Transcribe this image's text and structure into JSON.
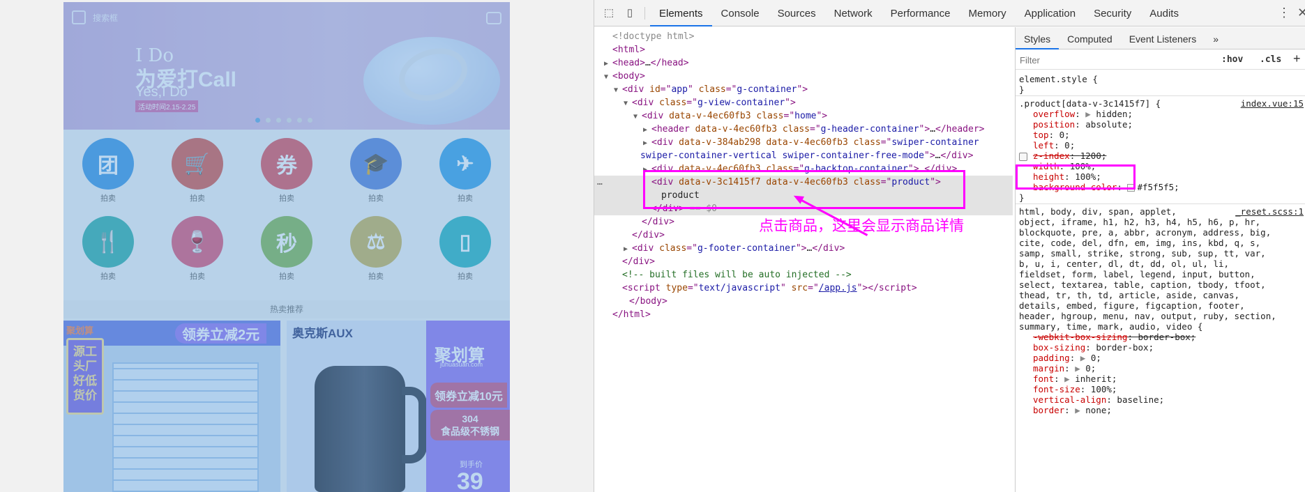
{
  "page": {
    "search_placeholder": "搜索框",
    "banner": {
      "line1": "I Do",
      "line2": "为爱打Call",
      "line3": "Yes,I Do",
      "line4": "活动时间2.15-2.25"
    },
    "dots_count": 6,
    "categories": [
      {
        "icon": "团",
        "label": "拍卖",
        "color": "#2f8ee0",
        "icon_name": "group-buy-icon"
      },
      {
        "icon": "🛒",
        "label": "拍卖",
        "color": "#d74b3c",
        "icon_name": "cart-icon"
      },
      {
        "icon": "券",
        "label": "拍卖",
        "color": "#e0464f",
        "icon_name": "coupon-icon"
      },
      {
        "icon": "🎓",
        "label": "拍卖",
        "color": "#4d78d6",
        "icon_name": "graduation-icon"
      },
      {
        "icon": "✈",
        "label": "拍卖",
        "color": "#2a9be6",
        "icon_name": "plane-icon"
      },
      {
        "icon": "🍴",
        "label": "拍卖",
        "color": "#23a9a0",
        "icon_name": "fork-knife-icon"
      },
      {
        "icon": "🍷",
        "label": "拍卖",
        "color": "#e14a6b",
        "icon_name": "wine-icon"
      },
      {
        "icon": "秒",
        "label": "拍卖",
        "color": "#7cb342",
        "icon_name": "flash-sale-icon"
      },
      {
        "icon": "⚖",
        "label": "拍卖",
        "color": "#c8b04a",
        "icon_name": "hammer-icon"
      },
      {
        "icon": "▯",
        "label": "拍卖",
        "color": "#1ab0b8",
        "icon_name": "phone-icon"
      }
    ],
    "section_title": "热卖推荐",
    "product1": {
      "brand": "聚划算",
      "coupon": "领券立减2元",
      "tag": "源工头厂好低货价"
    },
    "product2": {
      "brand": "奥克斯AUX",
      "jhs": "聚划算",
      "jhs_en": "juhuasuan.com",
      "coupon": "领券立减10元",
      "spec_line1": "304",
      "spec_line2": "食品级不锈钢",
      "price_label": "到手价",
      "price": "39"
    }
  },
  "devtools": {
    "tabs": [
      "Elements",
      "Console",
      "Sources",
      "Network",
      "Performance",
      "Memory",
      "Application",
      "Security",
      "Audits"
    ],
    "active_tab": "Elements",
    "dom_lines": [
      {
        "indent": 0,
        "tri": "",
        "html": "<span class='dim'>&lt;!doctype html&gt;</span>"
      },
      {
        "indent": 0,
        "tri": "",
        "html": "<span class='tag'>&lt;html&gt;</span>"
      },
      {
        "indent": 0,
        "tri": "▶",
        "html": "<span class='tag'>&lt;head&gt;</span><span class='txt'>…</span><span class='tag'>&lt;/head&gt;</span>"
      },
      {
        "indent": 0,
        "tri": "▼",
        "html": "<span class='tag'>&lt;body&gt;</span>"
      },
      {
        "indent": 1,
        "tri": "▼",
        "html": "<span class='tag'>&lt;div </span><span class='attr'>id</span><span class='tag'>=\"</span><span class='val'>app</span><span class='tag'>\" </span><span class='attr'>class</span><span class='tag'>=\"</span><span class='val'>g-container</span><span class='tag'>\"&gt;</span>"
      },
      {
        "indent": 2,
        "tri": "▼",
        "html": "<span class='tag'>&lt;div </span><span class='attr'>class</span><span class='tag'>=\"</span><span class='val'>g-view-container</span><span class='tag'>\"&gt;</span>"
      },
      {
        "indent": 3,
        "tri": "▼",
        "html": "<span class='tag'>&lt;div </span><span class='attr'>data-v-4ec60fb3 class</span><span class='tag'>=\"</span><span class='val'>home</span><span class='tag'>\"&gt;</span>"
      },
      {
        "indent": 4,
        "tri": "▶",
        "html": "<span class='tag'>&lt;header </span><span class='attr'>data-v-4ec60fb3 class</span><span class='tag'>=\"</span><span class='val'>g-header-container</span><span class='tag'>\"&gt;</span><span class='txt'>…</span><span class='tag'>&lt;/header&gt;</span>"
      },
      {
        "indent": 4,
        "tri": "▶",
        "html": "<span class='tag'>&lt;div </span><span class='attr'>data-v-384ab298 data-v-4ec60fb3 class</span><span class='tag'>=\"</span><span class='val'>swiper-container</span>"
      },
      {
        "indent": 4,
        "tri": "",
        "html": "<span class='val'>swiper-container-vertical swiper-container-free-mode</span><span class='tag'>\"&gt;</span><span class='txt'>…</span><span class='tag'>&lt;/div&gt;</span>",
        "wrap": true
      },
      {
        "indent": 4,
        "tri": "▶",
        "html": "<span class='tag'>&lt;div </span><span class='attr'>data-v-4ec60fb3 class</span><span class='tag'>=\"</span><span class='val'>g-backtop-container</span><span class='tag'>\"&gt;</span><span class='txt'>…</span><span class='tag'>&lt;/div&gt;</span>"
      },
      {
        "indent": 4,
        "tri": "",
        "html": "<span class='tag'>&lt;div </span><span class='attr'>data-v-3c1415f7 data-v-4ec60fb3 class</span><span class='tag'>=\"</span><span class='val'>product</span><span class='tag'>\"&gt;</span>",
        "hl": true
      },
      {
        "indent": 5,
        "tri": "",
        "html": "<span class='txt'>product</span>",
        "hl": true
      },
      {
        "indent": 4,
        "tri": "",
        "html": "<span class='tag'>&lt;/div&gt;</span><span class='dim'> == $0</span>",
        "hl": true
      },
      {
        "indent": 3,
        "tri": "",
        "html": "<span class='tag'>&lt;/div&gt;</span>"
      },
      {
        "indent": 2,
        "tri": "",
        "html": "<span class='tag'>&lt;/div&gt;</span>"
      },
      {
        "indent": 2,
        "tri": "▶",
        "html": "<span class='tag'>&lt;div </span><span class='attr'>class</span><span class='tag'>=\"</span><span class='val'>g-footer-container</span><span class='tag'>\"&gt;</span><span class='txt'>…</span><span class='tag'>&lt;/div&gt;</span>"
      },
      {
        "indent": 1,
        "tri": "",
        "html": "<span class='tag'>&lt;/div&gt;</span>"
      },
      {
        "indent": 1,
        "tri": "",
        "html": "<span class='cmt'>&lt;!-- built files will be auto injected --&gt;</span>"
      },
      {
        "indent": 1,
        "tri": "",
        "html": "<span class='tag'>&lt;script </span><span class='attr'>type</span><span class='tag'>=\"</span><span class='val'>text/javascript</span><span class='tag'>\" </span><span class='attr'>src</span><span class='tag'>=\"</span><span class='link'>/app.js</span><span class='tag'>\"&gt;&lt;/script&gt;</span>"
      },
      {
        "indent": 0,
        "tri": "",
        "html": "<span class='tag'>&lt;/body&gt;</span>",
        "pad": 24
      },
      {
        "indent": 0,
        "tri": "",
        "html": "<span class='tag'>&lt;/html&gt;</span>"
      }
    ],
    "annotation": "点击商品，这里会显示商品详情",
    "styles_tabs": [
      "Styles",
      "Computed",
      "Event Listeners",
      "»"
    ],
    "filter_placeholder": "Filter",
    "hov": ":hov",
    "cls": ".cls",
    "plus": "+",
    "style_lines": [
      {
        "t": "sel",
        "text": "element.style {"
      },
      {
        "t": "sel",
        "text": "}"
      },
      {
        "t": "div"
      },
      {
        "t": "rule",
        "text": ".product[data-v-3c1415f7] {",
        "src": "index.vue:15"
      },
      {
        "t": "prop",
        "name": "overflow",
        "arrow": true,
        "value": "hidden;"
      },
      {
        "t": "prop",
        "name": "position",
        "value": "absolute;"
      },
      {
        "t": "prop",
        "name": "top",
        "value": "0;"
      },
      {
        "t": "prop",
        "name": "left",
        "value": "0;"
      },
      {
        "t": "prop",
        "name": "z-index",
        "value": "1200;",
        "strike": true,
        "check": true
      },
      {
        "t": "prop",
        "name": "width",
        "value": "100%;"
      },
      {
        "t": "prop",
        "name": "height",
        "value": "100%;"
      },
      {
        "t": "prop",
        "name": "background-color",
        "value": "#f5f5f5;",
        "swatch": true
      },
      {
        "t": "sel",
        "text": "}"
      },
      {
        "t": "div"
      },
      {
        "t": "rule",
        "text": "html, body, div, span, applet,",
        "src": "_reset.scss:1"
      },
      {
        "t": "sel",
        "text": "object, iframe, h1, h2, h3, h4, h5, h6, p, hr,"
      },
      {
        "t": "sel",
        "text": "blockquote, pre, a, abbr, acronym, address, big,"
      },
      {
        "t": "sel",
        "text": "cite, code, del, dfn, em, img, ins, kbd, q, s,"
      },
      {
        "t": "sel",
        "text": "samp, small, strike, strong, sub, sup, tt, var,"
      },
      {
        "t": "sel",
        "text": "b, u, i, center, dl, dt, dd, ol, ul, li,"
      },
      {
        "t": "sel",
        "text": "fieldset, form, label, legend, input, button,"
      },
      {
        "t": "sel",
        "text": "select, textarea, table, caption, tbody, tfoot,"
      },
      {
        "t": "sel",
        "text": "thead, tr, th, td, article, aside, canvas,"
      },
      {
        "t": "sel",
        "text": "details, embed, figure, figcaption, footer,"
      },
      {
        "t": "sel",
        "text": "header, hgroup, menu, nav, output, ruby, section,"
      },
      {
        "t": "sel",
        "text": "summary, time, mark, audio, video {"
      },
      {
        "t": "prop",
        "name": "-webkit-box-sizing",
        "value": "border-box;",
        "strike": true
      },
      {
        "t": "prop",
        "name": "box-sizing",
        "value": "border-box;"
      },
      {
        "t": "prop",
        "name": "padding",
        "arrow": true,
        "value": "0;"
      },
      {
        "t": "prop",
        "name": "margin",
        "arrow": true,
        "value": "0;"
      },
      {
        "t": "prop",
        "name": "font",
        "arrow": true,
        "value": "inherit;"
      },
      {
        "t": "prop",
        "name": "font-size",
        "value": "100%;"
      },
      {
        "t": "prop",
        "name": "vertical-align",
        "value": "baseline;"
      },
      {
        "t": "prop",
        "name": "border",
        "arrow": true,
        "value": "none;"
      }
    ]
  }
}
